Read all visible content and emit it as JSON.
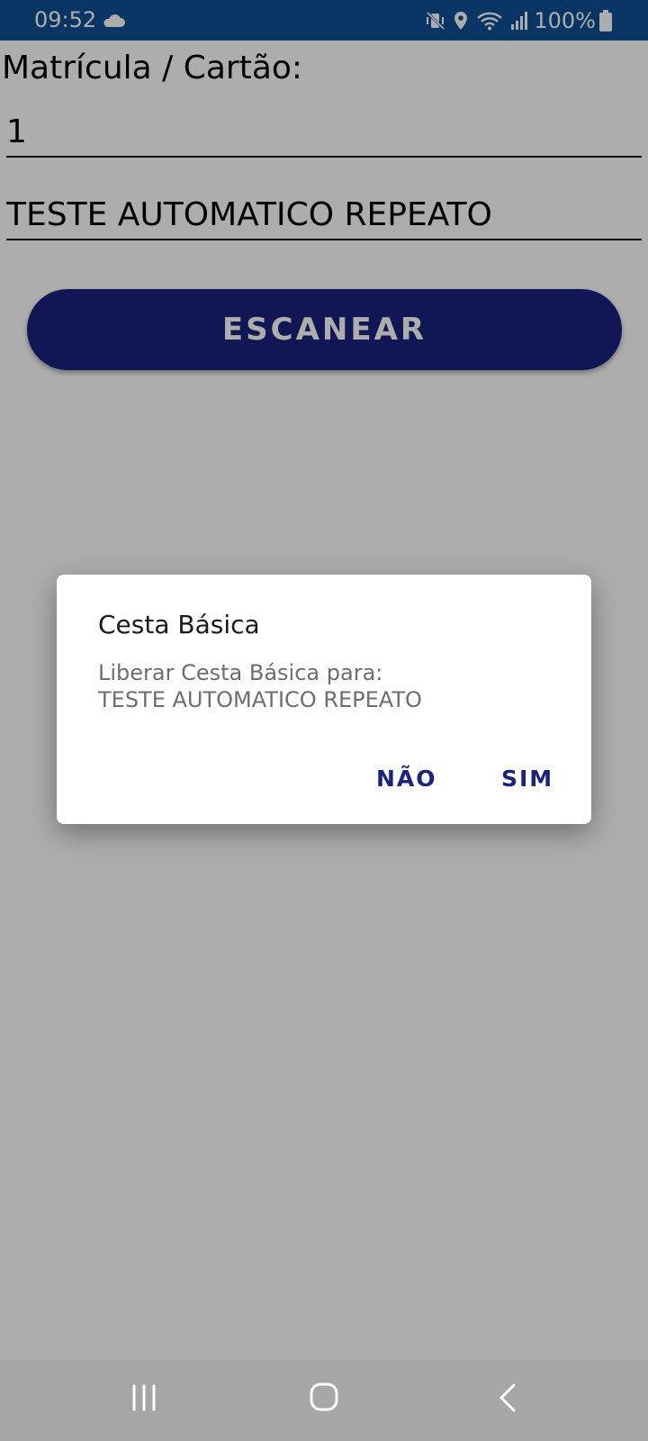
{
  "status_bar": {
    "time": "09:52",
    "battery": "100%",
    "icons": [
      "cloud-icon",
      "vibrate-mute-icon",
      "location-icon",
      "wifi-icon",
      "signal-icon",
      "battery-icon"
    ]
  },
  "form": {
    "label": "Matrícula / Cartão:",
    "card_value": "1",
    "name_value": "TESTE AUTOMATICO REPEATO",
    "scan_label": "ESCANEAR"
  },
  "dialog": {
    "title": "Cesta Básica",
    "message_line1": "Liberar Cesta Básica para:",
    "message_line2": "TESTE AUTOMATICO REPEATO",
    "no_label": "NÃO",
    "yes_label": "SIM"
  },
  "nav_bar": {
    "icons": [
      "recent-apps-icon",
      "home-icon",
      "back-icon"
    ]
  },
  "colors": {
    "status_bar": "#0d4f94",
    "primary": "#1a237e",
    "dialog_text": "#6e6e6e"
  }
}
